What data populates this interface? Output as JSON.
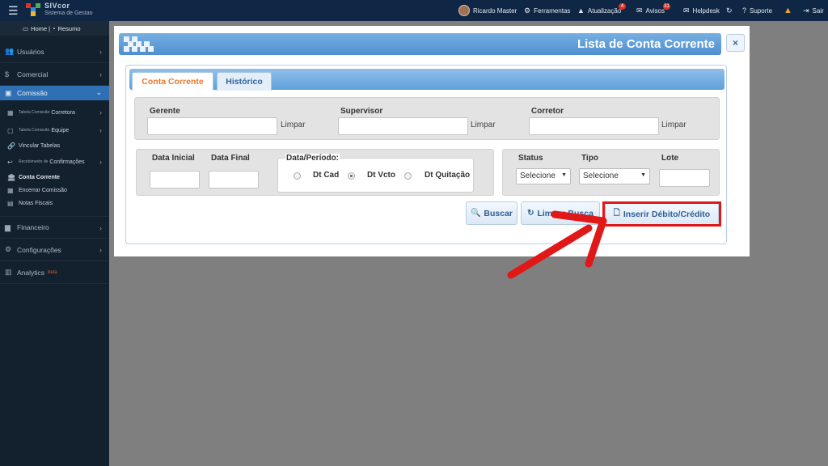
{
  "topbar": {
    "brand_name": "SIVcor",
    "brand_subtitle": "Sistema de Gestao",
    "user": "Ricardo Master",
    "items": [
      "Ferramentas",
      "Atualização",
      "Avisos",
      "Helpdesk",
      "Suporte",
      "Sair"
    ],
    "atualizacao_badge": "4",
    "avisos_badge": "31",
    "accent_color": "#0f2744"
  },
  "sidebar": {
    "home": "Home",
    "resumo": "Resumo",
    "items": [
      "Usuários",
      "Comercial",
      "Comissão",
      "Financeiro",
      "Configurações",
      "Analytics"
    ],
    "analytics_beta": "beta",
    "sub_prefix": "Tabela Comissão",
    "sub": [
      "Corretora",
      "Equipe",
      "Vincular Tabelas",
      "Confirmações",
      "Conta Corrente",
      "Encerrar Comissão",
      "Notas Fiscais"
    ],
    "recebimento_prefix": "Recebimento de",
    "active_color": "#2f6fb3"
  },
  "modal": {
    "title": "Lista de Conta Corrente",
    "close": "×",
    "tabs": [
      "Conta Corrente",
      "Histórico"
    ],
    "filters": {
      "gerente": "Gerente",
      "supervisor": "Supervisor",
      "corretor": "Corretor",
      "limpar": "Limpar",
      "data_inicial": "Data Inicial",
      "data_final": "Data Final",
      "periodo": "Data/Período:",
      "radio_options": [
        "Dt Cad",
        "Dt Vcto",
        "Dt Quitação"
      ],
      "radio_selected": "Dt Vcto",
      "status": "Status",
      "tipo": "Tipo",
      "lote": "Lote",
      "status_value": "Selecione",
      "tipo_value": "Selecione"
    },
    "buttons": {
      "buscar": "Buscar",
      "limpar_busca": "Limpar Busca",
      "inserir": "Inserir Débito/Crédito"
    },
    "highlight_color": "#e01818"
  }
}
